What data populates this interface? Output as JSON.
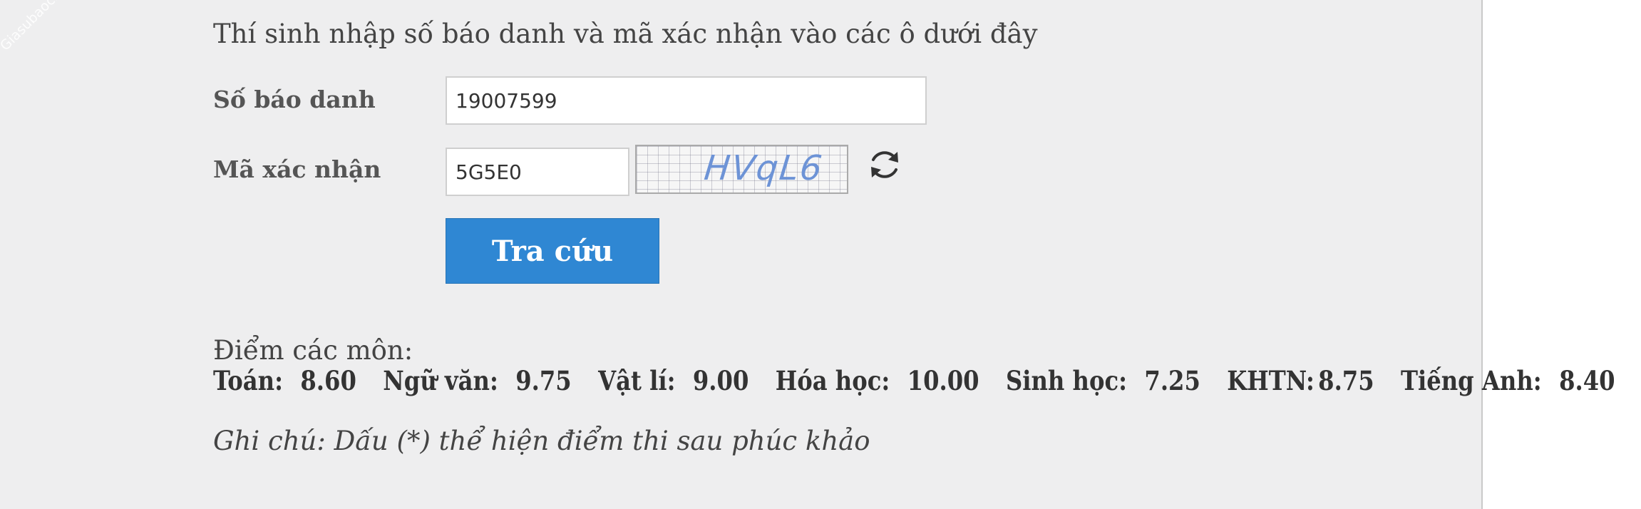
{
  "watermark": "Giasubaochau.net",
  "form": {
    "intro": "Thí sinh nhập số báo danh và mã xác nhận vào các ô dưới đây",
    "sbd_label": "Số báo danh",
    "sbd_value": "19007599",
    "captcha_label": "Mã xác nhận",
    "captcha_value": "5G5E0",
    "captcha_image_text": "HVqL6",
    "refresh_icon": "refresh-icon",
    "submit_label": "Tra cứu"
  },
  "results": {
    "heading": "Điểm các môn:",
    "subjects": [
      {
        "name": "Toán:",
        "score": "8.60"
      },
      {
        "name": "Ngữ văn:",
        "score": "9.75"
      },
      {
        "name": "Vật lí:",
        "score": "9.00"
      },
      {
        "name": "Hóa học:",
        "score": "10.00"
      },
      {
        "name": "Sinh học:",
        "score": "7.25"
      },
      {
        "name": "KHTN:",
        "score": "8.75"
      },
      {
        "name": "Tiếng Anh:",
        "score": "8.40"
      }
    ],
    "note": "Ghi chú: Dấu (*) thể hiện điểm thi sau phúc khảo"
  },
  "colors": {
    "panel_bg": "#eeeeef",
    "button_bg": "#2f87d3",
    "captcha_text": "#6d93d6"
  }
}
